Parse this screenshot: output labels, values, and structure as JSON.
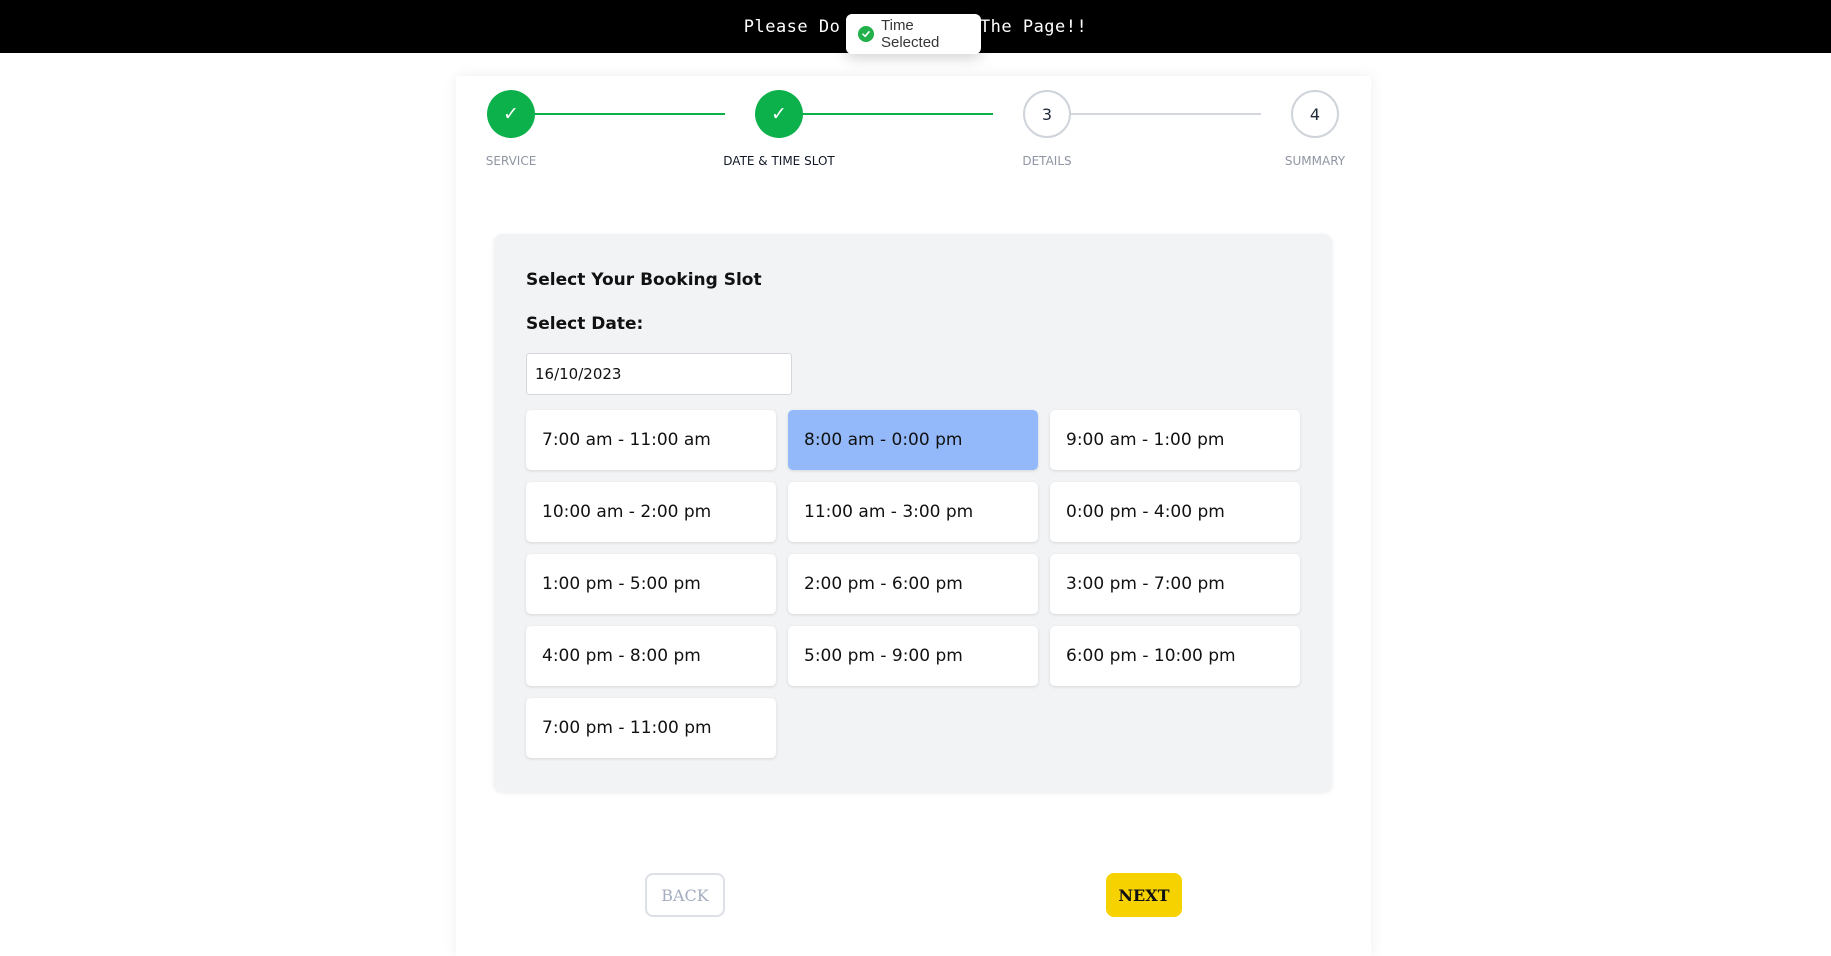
{
  "banner": {
    "text": "Please Do Not Refresh The Page!!"
  },
  "toast": {
    "text": "Time Selected",
    "icon": "check-circle-icon",
    "color": "#22b04b"
  },
  "stepper": {
    "steps": [
      {
        "label": "SERVICE",
        "mark": "✓",
        "state": "done"
      },
      {
        "label": "DATE & TIME SLOT",
        "mark": "✓",
        "state": "done"
      },
      {
        "label": "DETAILS",
        "mark": "3",
        "state": "todo"
      },
      {
        "label": "SUMMARY",
        "mark": "4",
        "state": "todo"
      }
    ],
    "done_color": "#0cb14b",
    "active_step": "DATE & TIME SLOT"
  },
  "booking": {
    "title": "Select Your Booking Slot",
    "date_label": "Select Date:",
    "date_value": "16/10/2023",
    "slots": [
      {
        "label": "7:00 am - 11:00 am",
        "selected": false
      },
      {
        "label": "8:00 am - 0:00 pm",
        "selected": true
      },
      {
        "label": "9:00 am - 1:00 pm",
        "selected": false
      },
      {
        "label": "10:00 am - 2:00 pm",
        "selected": false
      },
      {
        "label": "11:00 am - 3:00 pm",
        "selected": false
      },
      {
        "label": "0:00 pm - 4:00 pm",
        "selected": false
      },
      {
        "label": "1:00 pm - 5:00 pm",
        "selected": false
      },
      {
        "label": "2:00 pm - 6:00 pm",
        "selected": false
      },
      {
        "label": "3:00 pm - 7:00 pm",
        "selected": false
      },
      {
        "label": "4:00 pm - 8:00 pm",
        "selected": false
      },
      {
        "label": "5:00 pm - 9:00 pm",
        "selected": false
      },
      {
        "label": "6:00 pm - 10:00 pm",
        "selected": false
      },
      {
        "label": "7:00 pm - 11:00 pm",
        "selected": false
      }
    ],
    "selected_color": "#93b9fb"
  },
  "nav": {
    "back_label": "BACK",
    "next_label": "NEXT",
    "next_color": "#f5d200"
  }
}
